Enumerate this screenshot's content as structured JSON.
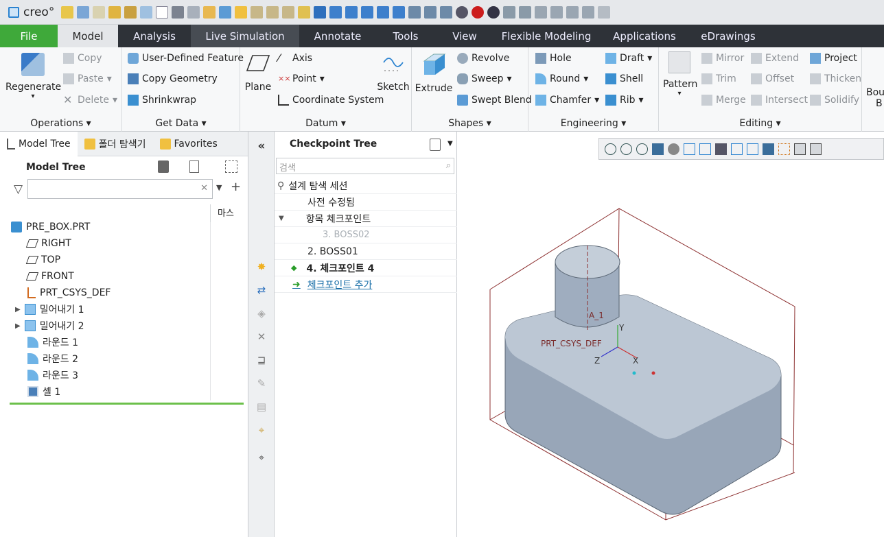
{
  "app": {
    "logo_text": "creo°"
  },
  "tabs": [
    {
      "label": "File"
    },
    {
      "label": "Model"
    },
    {
      "label": "Analysis"
    },
    {
      "label": "Live Simulation"
    },
    {
      "label": "Annotate"
    },
    {
      "label": "Tools"
    },
    {
      "label": "View"
    },
    {
      "label": "Flexible Modeling"
    },
    {
      "label": "Applications"
    },
    {
      "label": "eDrawings"
    }
  ],
  "ribbon": {
    "operations": {
      "regenerate": "Regenerate",
      "copy": "Copy",
      "paste": "Paste",
      "delete": "Delete",
      "label": "Operations ▾"
    },
    "get_data": {
      "udf": "User-Defined Feature",
      "copy_geometry": "Copy Geometry",
      "shrinkwrap": "Shrinkwrap",
      "label": "Get Data ▾"
    },
    "datum": {
      "plane": "Plane",
      "axis": "Axis",
      "point": "Point",
      "csys": "Coordinate System",
      "sketch": "Sketch",
      "label": "Datum ▾"
    },
    "shapes": {
      "extrude": "Extrude",
      "revolve": "Revolve",
      "sweep": "Sweep",
      "swept_blend": "Swept Blend",
      "label": "Shapes ▾"
    },
    "engineering": {
      "hole": "Hole",
      "draft": "Draft",
      "round": "Round",
      "shell": "Shell",
      "chamfer": "Chamfer",
      "rib": "Rib",
      "label": "Engineering ▾"
    },
    "editing": {
      "pattern": "Pattern",
      "mirror": "Mirror",
      "extend": "Extend",
      "project": "Project",
      "trim": "Trim",
      "offset": "Offset",
      "thicken": "Thicken",
      "merge": "Merge",
      "intersect": "Intersect",
      "solidify": "Solidify",
      "boundary": "Bou",
      "boundary2": "B",
      "label": "Editing ▾"
    }
  },
  "left_panel": {
    "tabs": [
      {
        "label": "Model Tree"
      },
      {
        "label": "폴더 탐색기"
      },
      {
        "label": "Favorites"
      }
    ],
    "header": "Model Tree",
    "column_header": "마스",
    "items": [
      {
        "label": "PRE_BOX.PRT"
      },
      {
        "label": "RIGHT"
      },
      {
        "label": "TOP"
      },
      {
        "label": "FRONT"
      },
      {
        "label": "PRT_CSYS_DEF"
      },
      {
        "label": "밀어내기 1"
      },
      {
        "label": "밀어내기 2"
      },
      {
        "label": "라운드 1"
      },
      {
        "label": "라운드 2"
      },
      {
        "label": "라운드 3"
      },
      {
        "label": "셀 1"
      }
    ]
  },
  "checkpoint": {
    "title": "Checkpoint Tree",
    "search_placeholder": "검색",
    "items": [
      {
        "label": "설계 탐색 세션"
      },
      {
        "label": "사전 수정됨"
      },
      {
        "label": "항목 체크포인트"
      },
      {
        "label": "3. BOSS02"
      },
      {
        "label": "2. BOSS01"
      },
      {
        "label": "4. 체크포인트 4"
      },
      {
        "label": "체크포인트 추가"
      }
    ]
  },
  "viewport": {
    "csys_label": "PRT_CSYS_DEF",
    "axis_label": "A_1",
    "x": "X",
    "y": "Y",
    "z": "Z"
  }
}
